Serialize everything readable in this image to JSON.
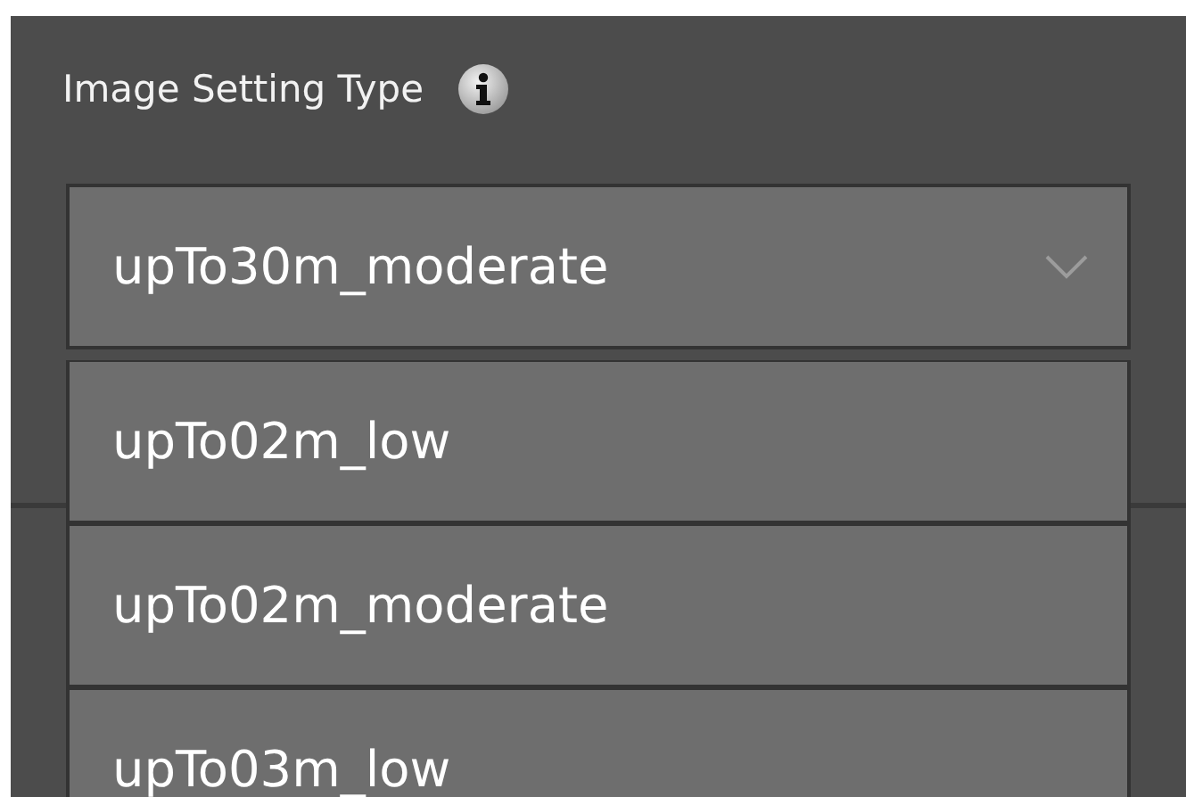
{
  "setting": {
    "label": "Image Setting Type"
  },
  "dropdown": {
    "value": "upTo30m_moderate",
    "expanded": true,
    "options": [
      {
        "label": "upTo02m_low",
        "selected": false
      },
      {
        "label": "upTo02m_moderate",
        "selected": false
      },
      {
        "label": "upTo03m_low",
        "selected": false
      }
    ]
  }
}
